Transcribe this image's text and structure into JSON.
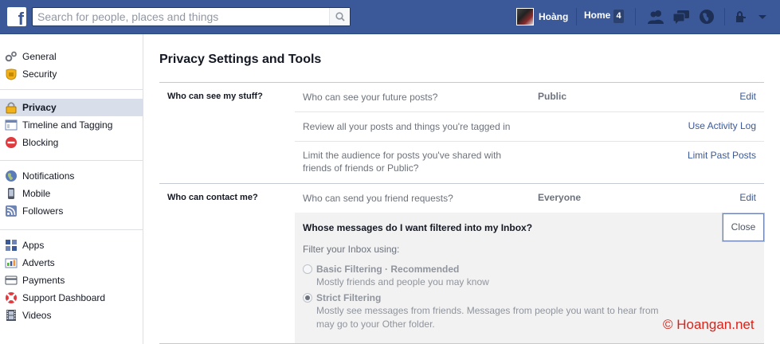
{
  "search": {
    "placeholder": "Search for people, places and things"
  },
  "header": {
    "user_name": "Hoàng",
    "home_label": "Home",
    "home_count": "4"
  },
  "sidebar": {
    "groups": [
      [
        {
          "label": "General",
          "icon": "gears-icon"
        },
        {
          "label": "Security",
          "icon": "badge-icon"
        }
      ],
      [
        {
          "label": "Privacy",
          "icon": "lock-icon",
          "active": true
        },
        {
          "label": "Timeline and Tagging",
          "icon": "timeline-icon"
        },
        {
          "label": "Blocking",
          "icon": "blocking-icon"
        }
      ],
      [
        {
          "label": "Notifications",
          "icon": "globe-icon"
        },
        {
          "label": "Mobile",
          "icon": "mobile-icon"
        },
        {
          "label": "Followers",
          "icon": "rss-icon"
        }
      ],
      [
        {
          "label": "Apps",
          "icon": "apps-icon"
        },
        {
          "label": "Adverts",
          "icon": "adverts-icon"
        },
        {
          "label": "Payments",
          "icon": "card-icon"
        },
        {
          "label": "Support Dashboard",
          "icon": "lifebuoy-icon"
        },
        {
          "label": "Videos",
          "icon": "film-icon"
        }
      ]
    ]
  },
  "main": {
    "title": "Privacy Settings and Tools",
    "sections": [
      {
        "label": "Who can see my stuff?",
        "rows": [
          {
            "question": "Who can see your future posts?",
            "value": "Public",
            "action": "Edit"
          },
          {
            "question": "Review all your posts and things you're tagged in",
            "value": "",
            "action": "Use Activity Log"
          },
          {
            "question": "Limit the audience for posts you've shared with friends of friends or Public?",
            "value": "",
            "action": "Limit Past Posts"
          }
        ]
      },
      {
        "label": "Who can contact me?",
        "rows": [
          {
            "question": "Who can send you friend requests?",
            "value": "Everyone",
            "action": "Edit"
          }
        ]
      }
    ],
    "expanded": {
      "title": "Whose messages do I want filtered into my Inbox?",
      "close_label": "Close",
      "subtitle": "Filter your Inbox using:",
      "options": [
        {
          "title": "Basic Filtering",
          "recommended": " · Recommended",
          "desc": "Mostly friends and people you may know",
          "checked": false
        },
        {
          "title": "Strict Filtering",
          "recommended": "",
          "desc": "Mostly see messages from friends. Messages from people you want to hear from may go to your Other folder.",
          "checked": true
        }
      ]
    }
  },
  "watermark": "© Hoangan.net",
  "colors": {
    "brand": "#3b5998",
    "link": "#3b5998",
    "active_nav": "#d8dfea",
    "watermark": "#d9231a"
  }
}
